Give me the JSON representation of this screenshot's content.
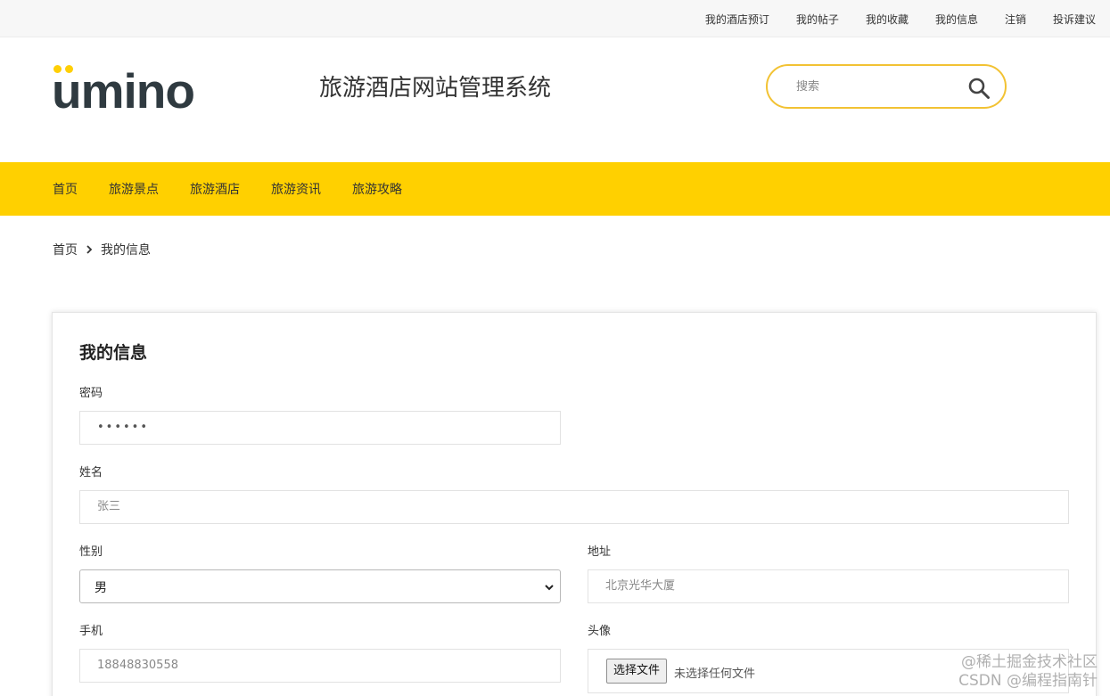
{
  "colors": {
    "accent": "#ffd000",
    "logo_dot": "#ffcf05",
    "logo_text": "#2f3a40",
    "search_border": "#f2c233"
  },
  "topbar": {
    "links": [
      "我的酒店预订",
      "我的帖子",
      "我的收藏",
      "我的信息",
      "注销",
      "投诉建议"
    ]
  },
  "header": {
    "logo_text": "umino",
    "site_title": "旅游酒店网站管理系统",
    "search_placeholder": "搜索",
    "search_icon": "magnifier-icon"
  },
  "nav": {
    "items": [
      "首页",
      "旅游景点",
      "旅游酒店",
      "旅游资讯",
      "旅游攻略"
    ]
  },
  "breadcrumb": {
    "home": "首页",
    "current": "我的信息",
    "separator_icon": "chevron-right-icon"
  },
  "form": {
    "title": "我的信息",
    "password_label": "密码",
    "password_value": "••••••",
    "name_label": "姓名",
    "name_value": "张三",
    "gender_label": "性别",
    "gender_value": "男",
    "address_label": "地址",
    "address_value": "北京光华大厦",
    "phone_label": "手机",
    "phone_value": "18848830558",
    "avatar_label": "头像",
    "file_button": "选择文件",
    "file_status": "未选择任何文件"
  },
  "watermark": {
    "line1": "@稀土掘金技术社区",
    "line2": "CSDN @编程指南针"
  }
}
